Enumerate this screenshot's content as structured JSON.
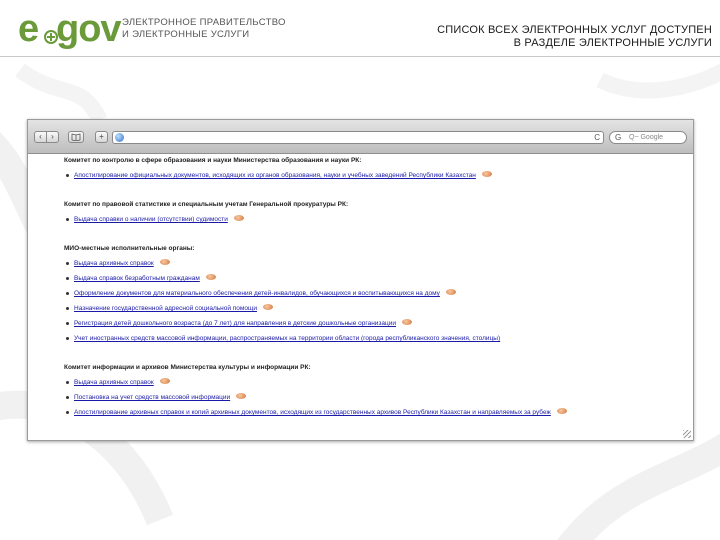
{
  "header": {
    "logo_e": "e",
    "logo_gov": "gov",
    "org_line1": "ЭЛЕКТРОННОЕ ПРАВИТЕЛЬСТВО",
    "org_line2": "И ЭЛЕКТРОННЫЕ УСЛУГИ",
    "headline_line1": "СПИСОК ВСЕХ ЭЛЕКТРОННЫХ УСЛУГ ДОСТУПЕН",
    "headline_line2": "В РАЗДЕЛЕ ЭЛЕКТРОННЫЕ УСЛУГИ",
    "brand_color": "#6a9a3a"
  },
  "browser": {
    "nav_back": "‹",
    "nav_forward": "›",
    "add_tab": "+",
    "reload_icon": "C",
    "search_engine_glyph": "G",
    "search_placeholder": "Q~ Google"
  },
  "sections": [
    {
      "title": "Комитет по контролю в сфере образования и науки Министерства образования и науки РК:",
      "items": [
        "Апостилирование официальных документов, исходящих из органов образования, науки и учебных заведений Республики Казахстан"
      ]
    },
    {
      "title": "Комитет по правовой статистике и специальным учетам Генеральной прокуратуры РК:",
      "items": [
        "Выдача справки о наличии (отсутствии) судимости"
      ]
    },
    {
      "title": "МИО-местные исполнительные органы:",
      "items": [
        "Выдача архивных справок",
        "Выдача справок безработным гражданам",
        "Оформление документов для материального обеспечения детей-инвалидов, обучающихся и воспитывающихся на дому",
        "Назначение государственной адресной социальной помощи",
        "Регистрация детей дошкольного возраста (до 7 лет) для направления в детские дошкольные организации",
        "Учет иностранных средств массовой информации, распространяемых на территории области (города республиканского значения, столицы)"
      ]
    },
    {
      "title": "Комитет информации и архивов Министерства культуры и информации РК:",
      "items": [
        "Выдача архивных справок",
        "Постановка на учет средств массовой информации",
        "Апостилирование архивных справок и копий архивных документов, исходящих из государственных архивов Республики Казахстан и направляемых за рубеж"
      ]
    }
  ]
}
